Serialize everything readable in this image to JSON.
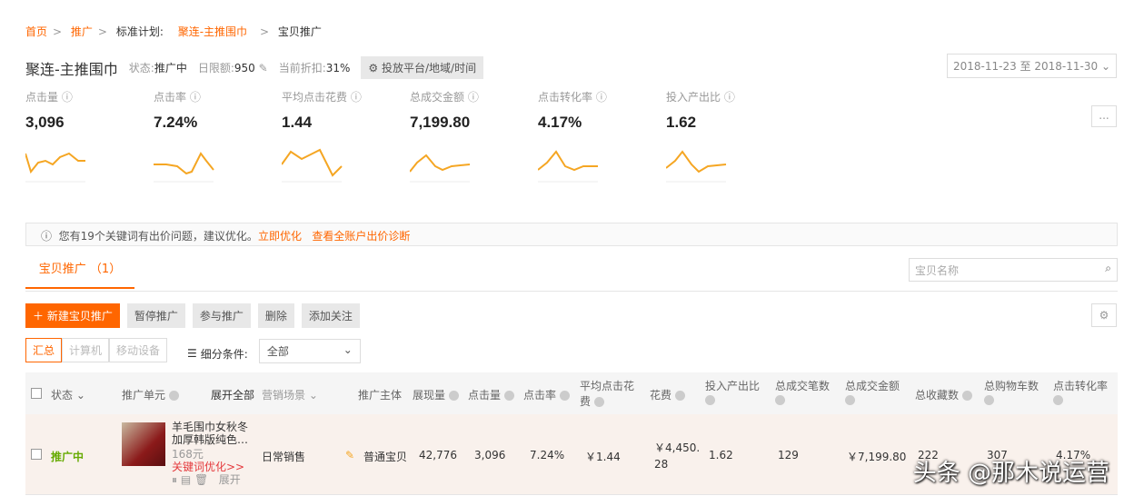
{
  "breadcrumb": {
    "home": "首页",
    "promo": "推广",
    "plan_label": "标准计划:",
    "plan": "聚连-主推围巾",
    "current": "宝贝推广"
  },
  "header": {
    "title": "聚连-主推围巾",
    "status_label": "状态:",
    "status": "推广中",
    "budget_label": "日限额:",
    "budget": "950",
    "discount_label": "当前折扣:",
    "discount": "31%",
    "platform_button": "投放平台/地域/时间",
    "date_range": "2018-11-23 至 2018-11-30"
  },
  "metrics": [
    {
      "label": "点击量",
      "value": "3,096"
    },
    {
      "label": "点击率",
      "value": "7.24%"
    },
    {
      "label": "平均点击花费",
      "value": "1.44"
    },
    {
      "label": "总成交金额",
      "value": "7,199.80"
    },
    {
      "label": "点击转化率",
      "value": "4.17%"
    },
    {
      "label": "投入产出比",
      "value": "1.62"
    }
  ],
  "more_label": "...",
  "notice": {
    "text": "您有19个关键词有出价问题，建议优化。",
    "link1": "立即优化",
    "link2": "查看全账户出价诊断"
  },
  "tab": "宝贝推广 （1）",
  "search_placeholder": "宝贝名称",
  "actions": {
    "new": "新建宝贝推广",
    "pause": "暂停推广",
    "join": "参与推广",
    "delete": "删除",
    "follow": "添加关注"
  },
  "segments": [
    "汇总",
    "计算机",
    "移动设备"
  ],
  "filter": {
    "label": "细分条件:",
    "value": "全部"
  },
  "columns": {
    "status": "状态",
    "unit": "推广单元",
    "expand_all": "展开全部",
    "scene": "营销场景",
    "subject": "推广主体",
    "impressions": "展现量",
    "clicks": "点击量",
    "ctr": "点击率",
    "cpc": "平均点击花费",
    "cost": "花费",
    "roi": "投入产出比",
    "orders": "总成交笔数",
    "gmv": "总成交金额",
    "favs": "总收藏数",
    "carts": "总购物车数",
    "cvr": "点击转化率"
  },
  "row": {
    "status": "推广中",
    "title1": "羊毛围巾女秋冬",
    "title2": "加厚韩版纯色…",
    "price": "168元",
    "kw_link": "关键词优化>>",
    "expand": "展开",
    "scene": "日常销售",
    "subject": "普通宝贝",
    "impressions": "42,776",
    "clicks": "3,096",
    "ctr": "7.24%",
    "cpc": "￥1.44",
    "cost1": "￥4,450.",
    "cost2": "28",
    "roi": "1.62",
    "orders": "129",
    "gmv": "￥7,199.80",
    "favs": "222",
    "carts": "307",
    "cvr": "4.17%"
  },
  "watermark": "头条 @那木说运营",
  "colors": {
    "accent": "#ff6600",
    "active": "#66aa00",
    "link": "#e4393c"
  }
}
